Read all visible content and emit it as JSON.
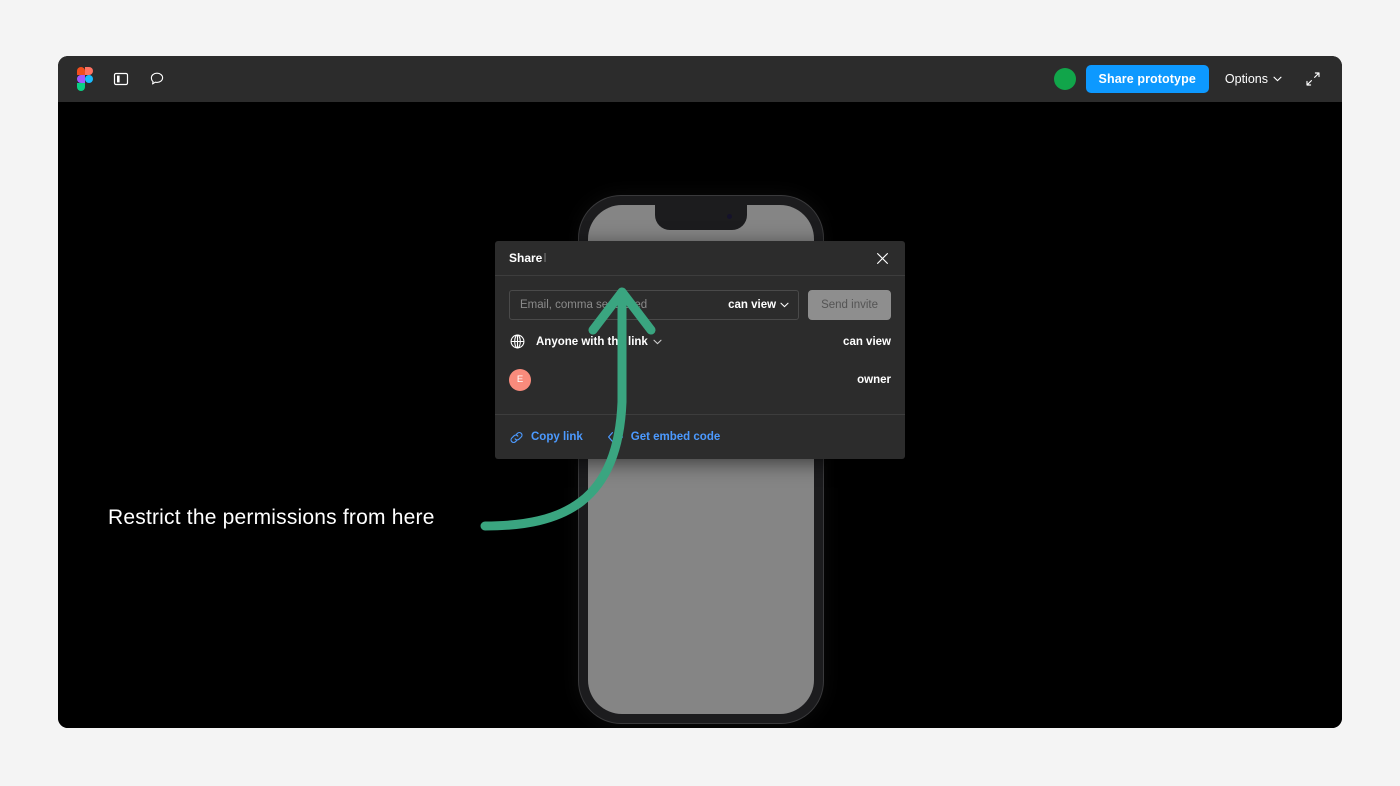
{
  "toolbar": {
    "logo_icon": "figma-logo-icon",
    "panel_icon": "layers-panel-icon",
    "comment_icon": "comment-bubble-icon",
    "presence_icon": "presence-avatar-dot",
    "share_prototype_label": "Share prototype",
    "options_label": "Options",
    "options_chevron_icon": "chevron-down-icon",
    "fullscreen_icon": "expand-fullscreen-icon"
  },
  "dialog": {
    "title": "Share",
    "title_truncated_glyph": "l",
    "close_icon": "close-x-icon",
    "invite": {
      "email_placeholder": "Email, comma separated",
      "email_value": "",
      "permission_label": "can view",
      "permission_chevron_icon": "chevron-down-icon",
      "send_invite_label": "Send invite"
    },
    "access_rows": [
      {
        "icon": "globe-icon",
        "label": "Anyone with the link",
        "chevron_icon": "chevron-down-icon",
        "permission": "can view"
      },
      {
        "icon": "user-avatar",
        "avatar_initial": "E",
        "avatar_color": "#f98b7c",
        "label": "",
        "permission": "owner"
      }
    ],
    "footer": {
      "copy_link_icon": "link-chain-icon",
      "copy_link_label": "Copy link",
      "embed_icon": "code-brackets-icon",
      "embed_label": "Get embed code"
    }
  },
  "canvas": {
    "phone_mockup_icon": "iphone-device-frame"
  },
  "annotation": {
    "text": "Restrict the permissions from here",
    "arrow_icon": "curved-arrow-up-icon",
    "arrow_color": "#3aa580"
  },
  "colors": {
    "accent_blue": "#0d99ff",
    "link_blue": "#4c9aff",
    "presence_green": "#11a54a",
    "annotation_green": "#3aa580",
    "toolbar_bg": "#2c2c2c",
    "canvas_bg": "#000000",
    "page_bg": "#f4f4f4"
  }
}
